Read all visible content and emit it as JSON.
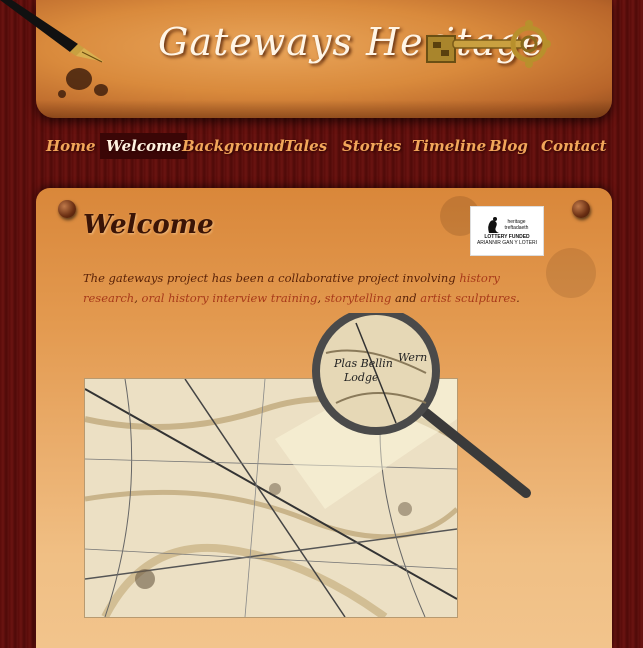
{
  "header": {
    "title": "Gateways Heritage"
  },
  "nav": {
    "items": [
      {
        "label": "Home"
      },
      {
        "label": "Welcome"
      },
      {
        "label": "Background"
      },
      {
        "label": "Tales"
      },
      {
        "label": "Stories"
      },
      {
        "label": "Timeline"
      },
      {
        "label": "Blog"
      },
      {
        "label": "Contact"
      }
    ],
    "active": "Welcome"
  },
  "main": {
    "title": "Welcome",
    "intro": {
      "text_before": "The gateways project has been a collaborative project involving ",
      "link1": "history research",
      "sep1": ", ",
      "link2": "oral history interview training",
      "sep2": ", ",
      "link3": "storytelling",
      "sep3": " and ",
      "link4": "artist sculptures",
      "end": "."
    },
    "logo": {
      "line1": "heritage",
      "line2": "treftadaeth",
      "line3": "LOTTERY FUNDED",
      "line4": "ARIANNIR GAN Y LOTERI"
    },
    "map": {
      "zoom_label1": "Plas Bellin",
      "zoom_label2": "Lodge",
      "zoom_label3": "Wern"
    }
  },
  "colors": {
    "background": "#5a0c0a",
    "nav_text": "#f2a65a",
    "nav_active_bg": "#3a0606",
    "link": "#a83a1a"
  }
}
